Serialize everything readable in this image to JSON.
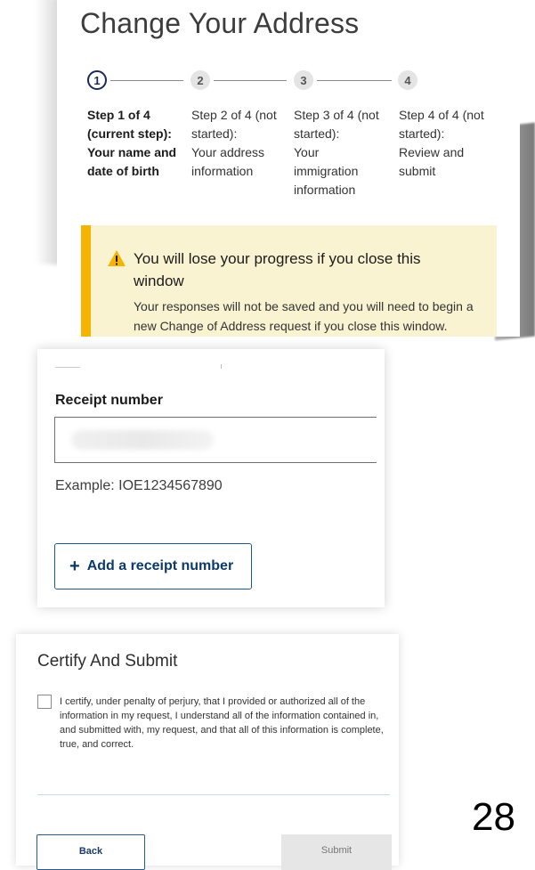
{
  "header": {
    "title": "Change Your Address"
  },
  "steps": [
    {
      "number": "1",
      "status": "current",
      "lines": [
        "Step 1 of 4",
        "(current step):",
        "Your name and",
        "date of birth"
      ]
    },
    {
      "number": "2",
      "status": "pending",
      "lines": [
        "Step 2 of 4 (not",
        "started):",
        "Your address",
        "information"
      ]
    },
    {
      "number": "3",
      "status": "pending",
      "lines": [
        "Step 3 of 4 (not",
        "started):",
        "Your",
        "immigration",
        "information"
      ]
    },
    {
      "number": "4",
      "status": "pending",
      "lines": [
        "Step 4 of 4 (not",
        "started):",
        "Review and",
        "submit"
      ]
    }
  ],
  "alert": {
    "title": "You will lose your progress if you close this window",
    "body": "Your responses will not be saved and you will need to begin a new Change of Address request if you close this window.",
    "accent_color": "#f5b400",
    "icon": "warning-icon"
  },
  "receipt": {
    "label": "Receipt number",
    "value": "",
    "example": "Example: IOE1234567890",
    "add_button": {
      "icon": "plus-icon",
      "label": "Add a receipt number"
    }
  },
  "certify": {
    "title": "Certify And Submit",
    "checkbox_checked": false,
    "text": "I certify, under penalty of perjury, that I provided or authorized all of the information in my request, I understand all of the information contained in, and submitted with, my request, and that all of this information is complete, true, and correct."
  },
  "buttons": {
    "back": "Back",
    "submit": "Submit"
  },
  "page_number": "28"
}
